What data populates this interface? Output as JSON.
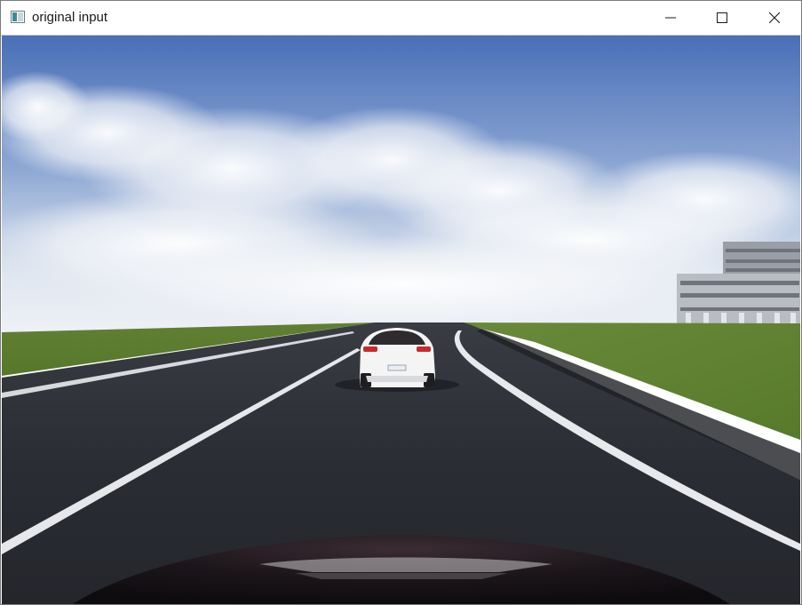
{
  "window": {
    "title": "original input",
    "controls": {
      "minimize": "minimize-icon",
      "maximize": "maximize-icon",
      "close": "close-icon"
    }
  },
  "scene": {
    "description_icon": "camera-view",
    "colors": {
      "sky_top": "#3f64b0",
      "sky_horizon": "#e6ebf2",
      "grass": "#5a7d2c",
      "road": "#2a2c33",
      "lane_marking": "#e8e8e8",
      "car": "#f2f2f2",
      "hood": "#151216"
    }
  }
}
